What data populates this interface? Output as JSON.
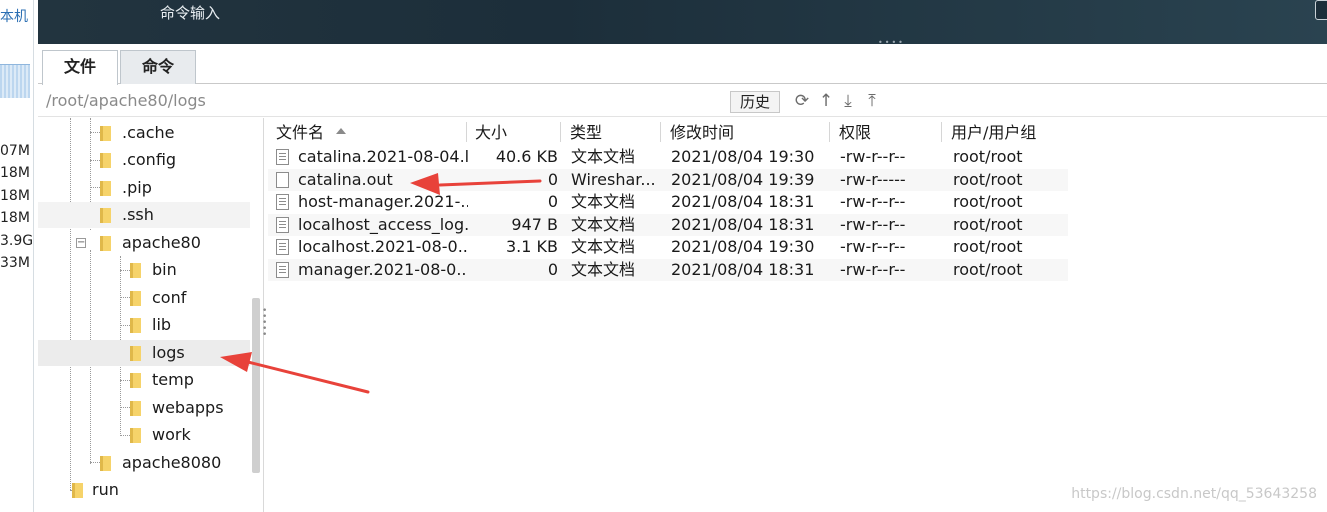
{
  "window": {
    "command_label": "命令输入"
  },
  "sidebar_sliver": {
    "title": "本机",
    "values": [
      "07M",
      "18M",
      "18M",
      "18M",
      "3.9G",
      "33M"
    ]
  },
  "tabs": [
    {
      "label": "文件",
      "active": true
    },
    {
      "label": "命令",
      "active": false
    }
  ],
  "pathbar": {
    "path": "/root/apache80/logs",
    "history_label": "历史",
    "icons": [
      "refresh-icon",
      "up-arrow-icon",
      "download-icon",
      "upload-icon"
    ]
  },
  "tree": {
    "items": [
      {
        "label": ".cache",
        "level": 1
      },
      {
        "label": ".config",
        "level": 1
      },
      {
        "label": ".pip",
        "level": 1
      },
      {
        "label": ".ssh",
        "level": 1
      },
      {
        "label": "apache80",
        "level": 1,
        "expanded": true
      },
      {
        "label": "bin",
        "level": 2
      },
      {
        "label": "conf",
        "level": 2
      },
      {
        "label": "lib",
        "level": 2
      },
      {
        "label": "logs",
        "level": 2,
        "selected": true
      },
      {
        "label": "temp",
        "level": 2
      },
      {
        "label": "webapps",
        "level": 2
      },
      {
        "label": "work",
        "level": 2
      },
      {
        "label": "apache8080",
        "level": 1
      },
      {
        "label": "run",
        "level": 0
      }
    ]
  },
  "file_list": {
    "columns": [
      "文件名",
      "大小",
      "类型",
      "修改时间",
      "权限",
      "用户/用户组"
    ],
    "rows": [
      {
        "name": "catalina.2021-08-04.l...",
        "size": "40.6 KB",
        "type": "文本文档",
        "modified": "2021/08/04 19:30",
        "perm": "-rw-r--r--",
        "owner": "root/root",
        "icon": "text-file-icon"
      },
      {
        "name": "catalina.out",
        "size": "0",
        "type": "Wireshar...",
        "modified": "2021/08/04 19:39",
        "perm": "-rw-r-----",
        "owner": "root/root",
        "icon": "blank-file-icon"
      },
      {
        "name": "host-manager.2021-...",
        "size": "0",
        "type": "文本文档",
        "modified": "2021/08/04 18:31",
        "perm": "-rw-r--r--",
        "owner": "root/root",
        "icon": "text-file-icon"
      },
      {
        "name": "localhost_access_log...",
        "size": "947 B",
        "type": "文本文档",
        "modified": "2021/08/04 18:31",
        "perm": "-rw-r--r--",
        "owner": "root/root",
        "icon": "text-file-icon"
      },
      {
        "name": "localhost.2021-08-0...",
        "size": "3.1 KB",
        "type": "文本文档",
        "modified": "2021/08/04 19:30",
        "perm": "-rw-r--r--",
        "owner": "root/root",
        "icon": "text-file-icon"
      },
      {
        "name": "manager.2021-08-0...",
        "size": "0",
        "type": "文本文档",
        "modified": "2021/08/04 18:31",
        "perm": "-rw-r--r--",
        "owner": "root/root",
        "icon": "text-file-icon"
      }
    ]
  },
  "annotation": {
    "arrow_color": "#e8423a"
  },
  "watermark": "https://blog.csdn.net/qq_53643258"
}
